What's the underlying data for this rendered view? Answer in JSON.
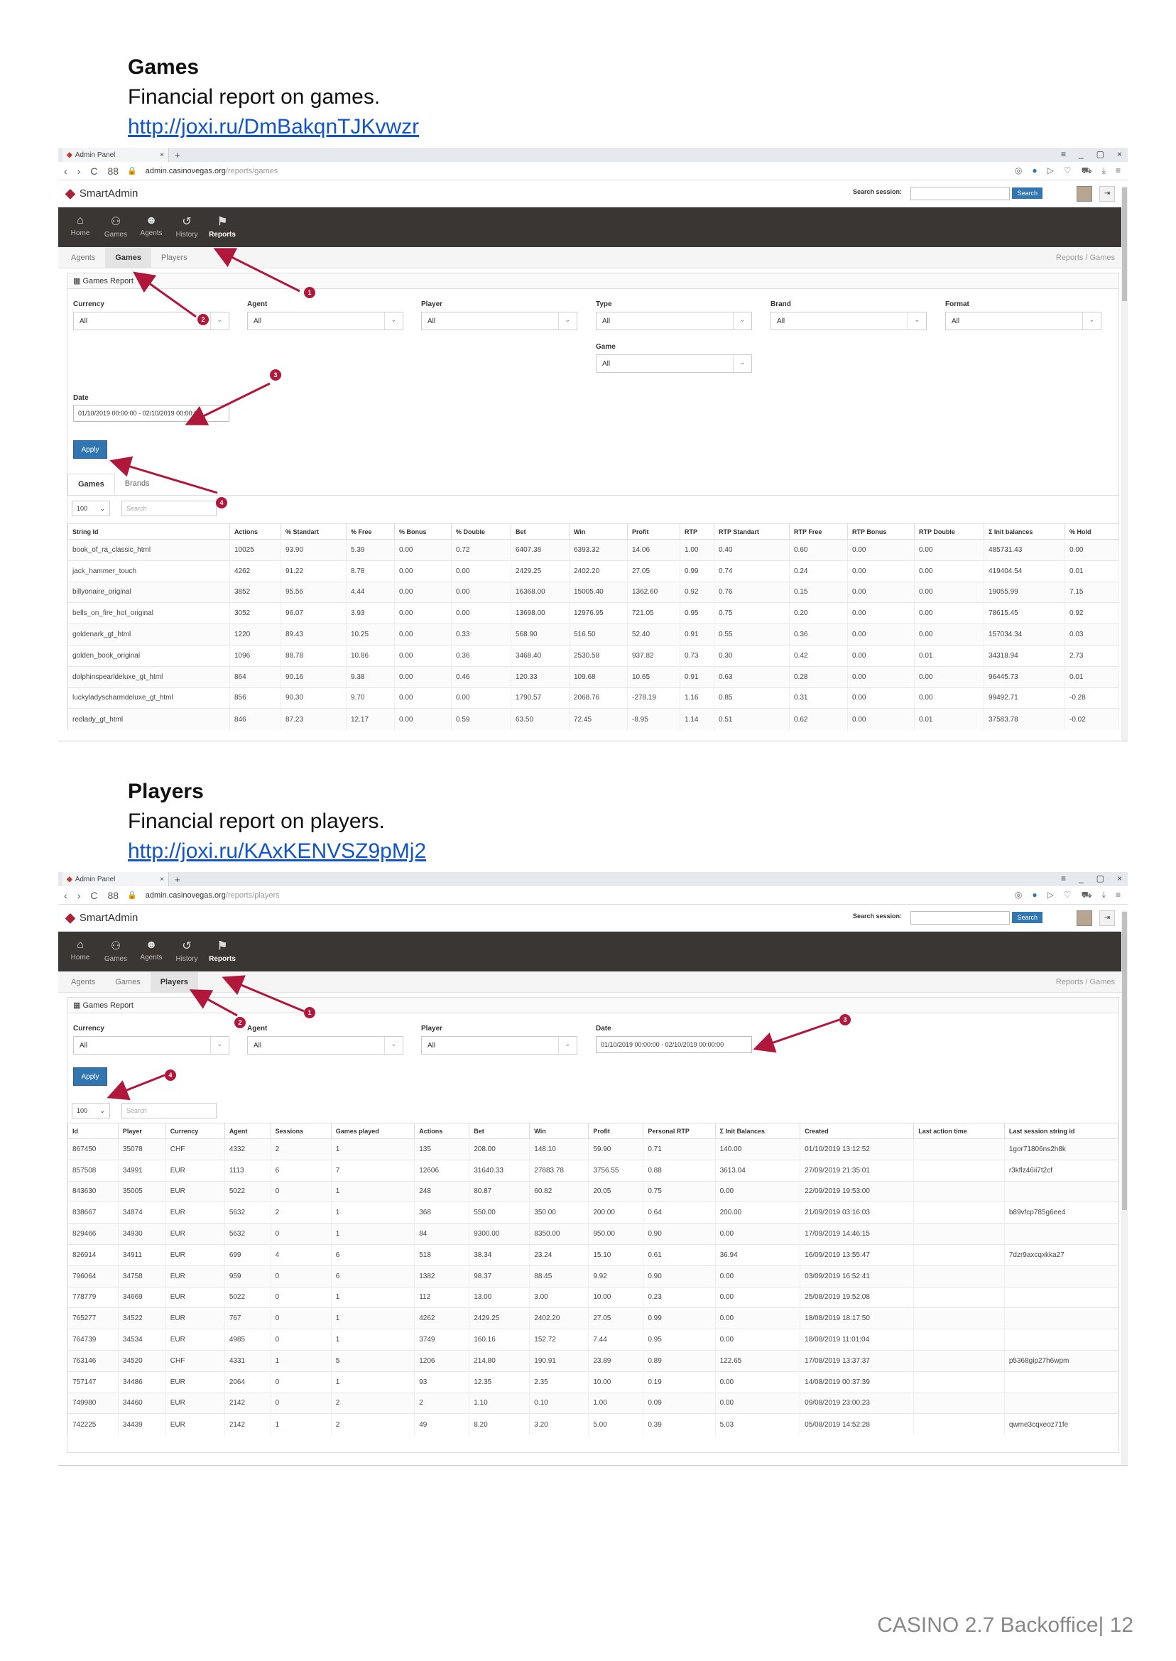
{
  "section1": {
    "title": "Games",
    "subtitle": "Financial report on games.",
    "link": "http://joxi.ru/DmBakqnTJKvwzr"
  },
  "section2": {
    "title": "Players",
    "subtitle": "Financial report on players.",
    "link": "http://joxi.ru/KAxKENVSZ9pMj2"
  },
  "browser": {
    "tab_title": "Admin Panel",
    "plus": "+",
    "back": "‹",
    "forward": "›",
    "reload": "C",
    "grid": "88",
    "url_host": "admin.casinovegas.org",
    "url_games_path": "/reports/games",
    "url_players_path": "/reports/players"
  },
  "app": {
    "brand": "SmartAdmin",
    "search_session_label": "Search session:",
    "search_button": "Search",
    "nav": [
      {
        "label": "Home",
        "icon": "home-icon",
        "glyph": "⌂"
      },
      {
        "label": "Games",
        "icon": "gamepad-icon",
        "glyph": "⚇"
      },
      {
        "label": "Agents",
        "icon": "user-icon",
        "glyph": "☻"
      },
      {
        "label": "History",
        "icon": "history-icon",
        "glyph": "↺"
      },
      {
        "label": "Reports",
        "icon": "flag-icon",
        "glyph": "⚑"
      }
    ],
    "subnav": [
      "Agents",
      "Games",
      "Players"
    ],
    "breadcrumb": "Reports /  Games",
    "panel_title": "Games Report",
    "apply": "Apply",
    "page_size": "100",
    "search_placeholder": "Search"
  },
  "games_report": {
    "filters": {
      "currency": {
        "label": "Currency",
        "value": "All"
      },
      "agent": {
        "label": "Agent",
        "value": "All"
      },
      "player": {
        "label": "Player",
        "value": "All"
      },
      "type": {
        "label": "Type",
        "value": "All"
      },
      "brand": {
        "label": "Brand",
        "value": "All"
      },
      "format": {
        "label": "Format",
        "value": "All"
      },
      "game": {
        "label": "Game",
        "value": "All"
      },
      "date": {
        "label": "Date",
        "value": "01/10/2019 00:00:00 - 02/10/2019 00:00:00"
      }
    },
    "tabs": [
      "Games",
      "Brands"
    ],
    "columns": [
      "String Id",
      "Actions",
      "% Standart",
      "% Free",
      "% Bonus",
      "% Double",
      "Bet",
      "Win",
      "Profit",
      "RTP",
      "RTP Standart",
      "RTP Free",
      "RTP Bonus",
      "RTP Double",
      "Σ Init balances",
      "% Hold"
    ],
    "rows": [
      [
        "book_of_ra_classic_html",
        "10025",
        "93.90",
        "5.39",
        "0.00",
        "0.72",
        "6407.38",
        "6393.32",
        "14.06",
        "1.00",
        "0.40",
        "0.60",
        "0.00",
        "0.00",
        "485731.43",
        "0.00"
      ],
      [
        "jack_hammer_touch",
        "4262",
        "91.22",
        "8.78",
        "0.00",
        "0.00",
        "2429.25",
        "2402.20",
        "27.05",
        "0.99",
        "0.74",
        "0.24",
        "0.00",
        "0.00",
        "419404.54",
        "0.01"
      ],
      [
        "billyonaire_original",
        "3852",
        "95.56",
        "4.44",
        "0.00",
        "0.00",
        "16368.00",
        "15005.40",
        "1362.60",
        "0.92",
        "0.76",
        "0.15",
        "0.00",
        "0.00",
        "19055.99",
        "7.15"
      ],
      [
        "bells_on_fire_hot_original",
        "3052",
        "96.07",
        "3.93",
        "0.00",
        "0.00",
        "13698.00",
        "12976.95",
        "721.05",
        "0.95",
        "0.75",
        "0.20",
        "0.00",
        "0.00",
        "78615.45",
        "0.92"
      ],
      [
        "goldenark_gt_html",
        "1220",
        "89.43",
        "10.25",
        "0.00",
        "0.33",
        "568.90",
        "516.50",
        "52.40",
        "0.91",
        "0.55",
        "0.36",
        "0.00",
        "0.00",
        "157034.34",
        "0.03"
      ],
      [
        "golden_book_original",
        "1096",
        "88.78",
        "10.86",
        "0.00",
        "0.36",
        "3468.40",
        "2530.58",
        "937.82",
        "0.73",
        "0.30",
        "0.42",
        "0.00",
        "0.01",
        "34318.94",
        "2.73"
      ],
      [
        "dolphinspearldeluxe_gt_html",
        "864",
        "90.16",
        "9.38",
        "0.00",
        "0.46",
        "120.33",
        "109.68",
        "10.65",
        "0.91",
        "0.63",
        "0.28",
        "0.00",
        "0.00",
        "96445.73",
        "0.01"
      ],
      [
        "luckyladyscharmdeluxe_gt_html",
        "856",
        "90.30",
        "9.70",
        "0.00",
        "0.00",
        "1790.57",
        "2068.76",
        "-278.19",
        "1.16",
        "0.85",
        "0.31",
        "0.00",
        "0.00",
        "99492.71",
        "-0.28"
      ],
      [
        "redlady_gt_html",
        "846",
        "87.23",
        "12.17",
        "0.00",
        "0.59",
        "63.50",
        "72.45",
        "-8.95",
        "1.14",
        "0.51",
        "0.62",
        "0.00",
        "0.01",
        "37583.78",
        "-0.02"
      ]
    ]
  },
  "players_report": {
    "filters": {
      "currency": {
        "label": "Currency",
        "value": "All"
      },
      "agent": {
        "label": "Agent",
        "value": "All"
      },
      "player": {
        "label": "Player",
        "value": "All"
      },
      "date": {
        "label": "Date",
        "value": "01/10/2019 00:00:00 - 02/10/2019 00:00:00"
      }
    },
    "columns": [
      "Id",
      "Player",
      "Currency",
      "Agent",
      "Sessions",
      "Games played",
      "Actions",
      "Bet",
      "Win",
      "Profit",
      "Personal RTP",
      "Σ Init Balances",
      "Created",
      "Last action time",
      "Last session string id"
    ],
    "rows": [
      [
        "867450",
        "35078",
        "CHF",
        "4332",
        "2",
        "1",
        "135",
        "208.00",
        "148.10",
        "59.90",
        "0.71",
        "140.00",
        "01/10/2019 13:12:52",
        "",
        "1gor71806ns2h8k"
      ],
      [
        "857508",
        "34991",
        "EUR",
        "1113",
        "6",
        "7",
        "12606",
        "31640.33",
        "27883.78",
        "3756.55",
        "0.88",
        "3613.04",
        "27/09/2019 21:35:01",
        "",
        "r3kflz46ii7t2cf"
      ],
      [
        "843630",
        "35005",
        "EUR",
        "5022",
        "0",
        "1",
        "248",
        "80.87",
        "60.82",
        "20.05",
        "0.75",
        "0.00",
        "22/09/2019 19:53:00",
        "",
        ""
      ],
      [
        "838667",
        "34874",
        "EUR",
        "5632",
        "2",
        "1",
        "368",
        "550.00",
        "350.00",
        "200.00",
        "0.64",
        "200.00",
        "21/09/2019 03:16:03",
        "",
        "b89vfcp785g6ee4"
      ],
      [
        "829466",
        "34930",
        "EUR",
        "5632",
        "0",
        "1",
        "84",
        "9300.00",
        "8350.00",
        "950.00",
        "0.90",
        "0.00",
        "17/09/2019 14:46:15",
        "",
        ""
      ],
      [
        "826914",
        "34911",
        "EUR",
        "699",
        "4",
        "6",
        "518",
        "38.34",
        "23.24",
        "15.10",
        "0.61",
        "36.94",
        "16/09/2019 13:55:47",
        "",
        "7dzr9axcqxkka27"
      ],
      [
        "796064",
        "34758",
        "EUR",
        "959",
        "0",
        "6",
        "1382",
        "98.37",
        "88.45",
        "9.92",
        "0.90",
        "0.00",
        "03/09/2019 16:52:41",
        "",
        ""
      ],
      [
        "778779",
        "34669",
        "EUR",
        "5022",
        "0",
        "1",
        "112",
        "13.00",
        "3.00",
        "10.00",
        "0.23",
        "0.00",
        "25/08/2019 19:52:08",
        "",
        ""
      ],
      [
        "765277",
        "34522",
        "EUR",
        "767",
        "0",
        "1",
        "4262",
        "2429.25",
        "2402.20",
        "27.05",
        "0.99",
        "0.00",
        "18/08/2019 18:17:50",
        "",
        ""
      ],
      [
        "764739",
        "34534",
        "EUR",
        "4985",
        "0",
        "1",
        "3749",
        "160.16",
        "152.72",
        "7.44",
        "0.95",
        "0.00",
        "18/08/2019 11:01:04",
        "",
        ""
      ],
      [
        "763146",
        "34520",
        "CHF",
        "4331",
        "1",
        "5",
        "1206",
        "214.80",
        "190.91",
        "23.89",
        "0.89",
        "122.65",
        "17/08/2019 13:37:37",
        "",
        "p5368gip27h6wpm"
      ],
      [
        "757147",
        "34486",
        "EUR",
        "2064",
        "0",
        "1",
        "93",
        "12.35",
        "2.35",
        "10.00",
        "0.19",
        "0.00",
        "14/08/2019 00:37:39",
        "",
        ""
      ],
      [
        "749980",
        "34460",
        "EUR",
        "2142",
        "0",
        "2",
        "2",
        "1.10",
        "0.10",
        "1.00",
        "0.09",
        "0.00",
        "09/08/2019 23:00:23",
        "",
        ""
      ],
      [
        "742225",
        "34439",
        "EUR",
        "2142",
        "1",
        "2",
        "49",
        "8.20",
        "3.20",
        "5.00",
        "0.39",
        "5.03",
        "05/08/2019 14:52:28",
        "",
        "qwme3cqxeoz71fe"
      ]
    ]
  },
  "annotations": [
    "1",
    "2",
    "3",
    "4"
  ],
  "colors": {
    "accent": "#3276b1",
    "annotation": "#b0173a",
    "navbar": "#3a3633",
    "negative": "#c62828"
  },
  "footer": "CASINO 2.7 Backoffice| 12"
}
